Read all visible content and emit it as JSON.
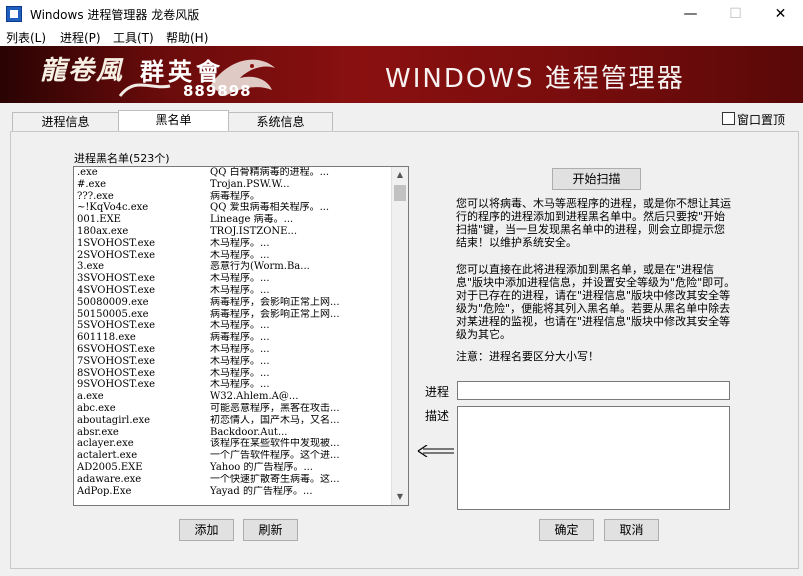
{
  "window": {
    "title": "Windows 进程管理器 龙卷风版",
    "minimize_glyph": "—",
    "maximize_glyph": "☐",
    "close_glyph": "✕"
  },
  "menu": [
    "列表(L)",
    "进程(P)",
    "工具(T)",
    "帮助(H)"
  ],
  "banner": {
    "logo_text": "龍卷風",
    "group_text": "群英會",
    "number": "889898",
    "title": "WINDOWS 進程管理器"
  },
  "tabs": [
    "进程信息",
    "黑名单",
    "系统信息"
  ],
  "active_tab": 1,
  "always_on_top_label": "窗口置顶",
  "blacklist": {
    "label": "进程黑名单(523个)",
    "rows": [
      [
        ".exe",
        "QQ 白骨精病毒的进程。..."
      ],
      [
        "#.exe",
        "Trojan.PSW.W..."
      ],
      [
        "???.exe",
        "病毒程序。"
      ],
      [
        "~!KqVo4c.exe",
        "QQ 爱虫病毒相关程序。..."
      ],
      [
        "001.EXE",
        "Lineage 病毒。..."
      ],
      [
        "180ax.exe",
        "TROJ.ISTZONE..."
      ],
      [
        "1SVOHOST.exe",
        "木马程序。..."
      ],
      [
        "2SVOHOST.exe",
        "木马程序。..."
      ],
      [
        "3.exe",
        "恶意行为(Worm.Ba..."
      ],
      [
        "3SVOHOST.exe",
        "木马程序。..."
      ],
      [
        "4SVOHOST.exe",
        "木马程序。..."
      ],
      [
        "50080009.exe",
        "病毒程序，会影响正常上网..."
      ],
      [
        "50150005.exe",
        "病毒程序，会影响正常上网..."
      ],
      [
        "5SVOHOST.exe",
        "木马程序。..."
      ],
      [
        "601118.exe",
        "病毒程序。..."
      ],
      [
        "6SVOHOST.exe",
        "木马程序。..."
      ],
      [
        "7SVOHOST.exe",
        "木马程序。..."
      ],
      [
        "8SVOHOST.exe",
        "木马程序。..."
      ],
      [
        "9SVOHOST.exe",
        "木马程序。..."
      ],
      [
        "a.exe",
        "W32.Ahlem.A@..."
      ],
      [
        "abc.exe",
        "可能恶意程序，黑客在攻击..."
      ],
      [
        "aboutagirl.exe",
        "初恋情人，国产木马，又名..."
      ],
      [
        "absr.exe",
        "Backdoor.Aut..."
      ],
      [
        "aclayer.exe",
        "该程序在某些软件中发现被..."
      ],
      [
        "actalert.exe",
        "一个广告软件程序。这个进..."
      ],
      [
        "AD2005.EXE",
        "Yahoo 的广告程序。..."
      ],
      [
        "adaware.exe",
        "一个快速扩散寄生病毒。这..."
      ],
      [
        "AdPop.Exe",
        "Yayad 的广告程序。..."
      ]
    ],
    "add_button": "添加",
    "refresh_button": "刷新"
  },
  "scan_button": "开始扫描",
  "info_paragraph_1": "您可以将病毒、木马等恶程序的进程，或是你不想让其运行的程序的进程添加到进程黑名单中。然后只要按\"开始扫描\"键，当一旦发现黑名单中的进程，则会立即提示您结束！以维护系统安全。",
  "info_paragraph_2": "您可以直接在此将进程添加到黑名单，或是在\"进程信息\"版块中添加进程信息，并设置安全等级为\"危险\"即可。对于已存在的进程，请在\"进程信息\"版块中修改其安全等级为\"危险\"，便能将其列入黑名单。若要从黑名单中除去对某进程的监视，也请在\"进程信息\"版块中修改其安全等级为其它。",
  "note": "注意：进程名要区分大小写！",
  "form": {
    "process_label": "进程",
    "process_value": "",
    "desc_label": "描述",
    "desc_value": "",
    "ok_button": "确定",
    "cancel_button": "取消"
  }
}
